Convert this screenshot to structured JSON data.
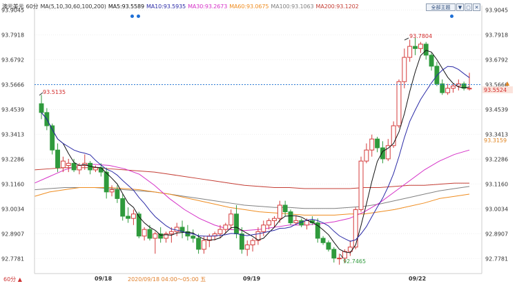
{
  "legend": {
    "symbol": "澳元美元",
    "period_sel": "60分",
    "ma_params": "MA(5,10,30,60,100,200)",
    "ma5": "MA5:93.5589",
    "ma10": "MA10:93.5935",
    "ma30": "MA30:93.2673",
    "ma60": "MA60:93.0675",
    "ma100": "MA100:93.1063",
    "ma200": "MA200:93.1202"
  },
  "toolbar": {
    "view_select": "全部主题",
    "btn_a": "▼",
    "btn_b": "▢",
    "btn_c": "✕"
  },
  "footer": {
    "period": "60分 ▲",
    "time_readout": "2020/09/18 04:00～05:00 五"
  },
  "annotations": {
    "mark_a": "93.5135",
    "mark_b": "93.7804",
    "mark_c": "92.7465",
    "last_arrow": "▲"
  },
  "chart_data": {
    "type": "candlestick",
    "x_labels": [
      "09/18",
      "09/19",
      "09/22"
    ],
    "yticks": [
      "93.9045",
      "93.7918",
      "93.6792",
      "93.5666",
      "93.4539",
      "93.3413",
      "93.2286",
      "93.1160",
      "93.0034",
      "92.8907",
      "92.7781"
    ],
    "ylim": [
      92.71,
      93.925
    ],
    "last_price": 93.5666,
    "last_price_label": "93.5666",
    "current_price": 93.5524,
    "current_price_label": "93.5524",
    "ma_ref_label": "93.3159",
    "colors": {
      "up": "#d43a3a",
      "down": "#2f9a3c",
      "ma5": "#111111",
      "ma10": "#2a2aa6",
      "ma30": "#d530c7",
      "ma60": "#ef8c1f",
      "ma100": "#808080",
      "ma200": "#c43c33"
    },
    "candles": [
      [
        93.48,
        93.52,
        93.41,
        93.44
      ],
      [
        93.44,
        93.46,
        93.36,
        93.38
      ],
      [
        93.38,
        93.39,
        93.25,
        93.27
      ],
      [
        93.27,
        93.3,
        93.17,
        93.19
      ],
      [
        93.19,
        93.24,
        93.17,
        93.22
      ],
      [
        93.2,
        93.23,
        93.17,
        93.21
      ],
      [
        93.21,
        93.23,
        93.17,
        93.18
      ],
      [
        93.18,
        93.21,
        93.16,
        93.2
      ],
      [
        93.2,
        93.25,
        93.18,
        93.21
      ],
      [
        93.21,
        93.22,
        93.16,
        93.18
      ],
      [
        93.18,
        93.2,
        93.17,
        93.19
      ],
      [
        93.19,
        93.21,
        93.15,
        93.17
      ],
      [
        93.17,
        93.19,
        93.05,
        93.08
      ],
      [
        93.08,
        93.11,
        93.06,
        93.09
      ],
      [
        93.09,
        93.11,
        93.03,
        93.05
      ],
      [
        93.05,
        93.07,
        92.95,
        92.97
      ],
      [
        92.97,
        93.01,
        92.94,
        92.96
      ],
      [
        92.96,
        93.0,
        92.93,
        92.98
      ],
      [
        92.98,
        92.99,
        92.87,
        92.88
      ],
      [
        92.88,
        92.92,
        92.86,
        92.91
      ],
      [
        92.91,
        92.93,
        92.86,
        92.87
      ],
      [
        92.87,
        92.9,
        92.8,
        92.89
      ],
      [
        92.89,
        92.92,
        92.85,
        92.87
      ],
      [
        92.87,
        92.9,
        92.85,
        92.89
      ],
      [
        92.89,
        92.92,
        92.85,
        92.9
      ],
      [
        92.9,
        92.94,
        92.88,
        92.92
      ],
      [
        92.92,
        92.95,
        92.87,
        92.9
      ],
      [
        92.9,
        92.93,
        92.86,
        92.88
      ],
      [
        92.88,
        92.91,
        92.85,
        92.87
      ],
      [
        92.87,
        92.89,
        92.8,
        92.82
      ],
      [
        92.82,
        92.88,
        92.8,
        92.86
      ],
      [
        92.86,
        92.89,
        92.83,
        92.88
      ],
      [
        92.88,
        92.9,
        92.86,
        92.89
      ],
      [
        92.89,
        92.93,
        92.87,
        92.91
      ],
      [
        92.91,
        92.94,
        92.89,
        92.93
      ],
      [
        92.93,
        93.0,
        92.91,
        92.98
      ],
      [
        92.98,
        93.02,
        92.87,
        92.89
      ],
      [
        92.89,
        92.92,
        92.8,
        92.82
      ],
      [
        92.82,
        92.86,
        92.79,
        92.84
      ],
      [
        92.84,
        92.87,
        92.81,
        92.86
      ],
      [
        92.86,
        92.92,
        92.84,
        92.9
      ],
      [
        92.9,
        92.95,
        92.88,
        92.93
      ],
      [
        92.93,
        92.96,
        92.91,
        92.95
      ],
      [
        92.95,
        92.97,
        92.92,
        92.96
      ],
      [
        92.96,
        93.04,
        92.94,
        93.02
      ],
      [
        93.02,
        93.04,
        92.97,
        92.99
      ],
      [
        92.99,
        93.0,
        92.93,
        92.94
      ],
      [
        92.94,
        92.97,
        92.93,
        92.95
      ],
      [
        92.95,
        92.96,
        92.92,
        92.93
      ],
      [
        92.93,
        92.96,
        92.91,
        92.95
      ],
      [
        92.95,
        92.97,
        92.93,
        92.94
      ],
      [
        92.94,
        92.96,
        92.85,
        92.87
      ],
      [
        92.87,
        92.88,
        92.84,
        92.85
      ],
      [
        92.85,
        92.86,
        92.81,
        92.82
      ],
      [
        92.82,
        92.83,
        92.76,
        92.78
      ],
      [
        92.78,
        92.8,
        92.75,
        92.78
      ],
      [
        92.78,
        92.82,
        92.76,
        92.81
      ],
      [
        92.81,
        92.86,
        92.79,
        92.83
      ],
      [
        92.83,
        93.01,
        92.82,
        93.0
      ],
      [
        93.0,
        93.24,
        92.99,
        93.22
      ],
      [
        93.22,
        93.3,
        93.21,
        93.27
      ],
      [
        93.27,
        93.34,
        93.24,
        93.32
      ],
      [
        93.32,
        93.33,
        93.26,
        93.28
      ],
      [
        93.28,
        93.31,
        93.21,
        93.23
      ],
      [
        93.23,
        93.32,
        93.22,
        93.29
      ],
      [
        93.29,
        93.4,
        93.28,
        93.38
      ],
      [
        93.38,
        93.59,
        93.37,
        93.58
      ],
      [
        93.58,
        93.73,
        93.55,
        93.69
      ],
      [
        93.69,
        93.77,
        93.67,
        93.74
      ],
      [
        93.74,
        93.78,
        93.7,
        93.73
      ],
      [
        93.73,
        93.76,
        93.71,
        93.75
      ],
      [
        93.75,
        93.76,
        93.68,
        93.7
      ],
      [
        93.7,
        93.71,
        93.63,
        93.65
      ],
      [
        93.65,
        93.67,
        93.56,
        93.57
      ],
      [
        93.57,
        93.59,
        93.52,
        93.53
      ],
      [
        93.53,
        93.57,
        93.52,
        93.55
      ],
      [
        93.55,
        93.57,
        93.53,
        93.56
      ],
      [
        93.56,
        93.59,
        93.54,
        93.57
      ],
      [
        93.57,
        93.58,
        93.54,
        93.55
      ],
      [
        93.55,
        93.62,
        93.54,
        93.55
      ]
    ],
    "ma_long": {
      "ma30": [
        93.12,
        93.15,
        93.18,
        93.2,
        93.205,
        93.2,
        93.185,
        93.16,
        93.11,
        93.05,
        93.0,
        92.96,
        92.93,
        92.91,
        92.905,
        92.91,
        92.92,
        92.93,
        92.93,
        92.935,
        92.945,
        92.96,
        92.99,
        93.03,
        93.08,
        93.13,
        93.18,
        93.22,
        93.25,
        93.27
      ],
      "ma60": [
        93.06,
        93.08,
        93.09,
        93.1,
        93.1,
        93.1,
        93.095,
        93.09,
        93.08,
        93.07,
        93.055,
        93.04,
        93.025,
        93.01,
        93.0,
        92.99,
        92.985,
        92.98,
        92.975,
        92.975,
        92.975,
        92.98,
        92.98,
        92.99,
        93.0,
        93.015,
        93.03,
        93.05,
        93.06,
        93.07
      ],
      "ma100": [
        93.09,
        93.095,
        93.1,
        93.1,
        93.1,
        93.095,
        93.09,
        93.085,
        93.08,
        93.07,
        93.06,
        93.05,
        93.04,
        93.03,
        93.02,
        93.015,
        93.01,
        93.01,
        93.005,
        93.005,
        93.005,
        93.01,
        93.015,
        93.025,
        93.04,
        93.055,
        93.07,
        93.085,
        93.095,
        93.105
      ],
      "ma200": [
        93.18,
        93.185,
        93.19,
        93.19,
        93.19,
        93.185,
        93.18,
        93.175,
        93.17,
        93.16,
        93.15,
        93.14,
        93.13,
        93.12,
        93.11,
        93.105,
        93.1,
        93.1,
        93.095,
        93.095,
        93.095,
        93.095,
        93.1,
        93.1,
        93.105,
        93.11,
        93.11,
        93.115,
        93.12,
        93.12
      ]
    }
  }
}
